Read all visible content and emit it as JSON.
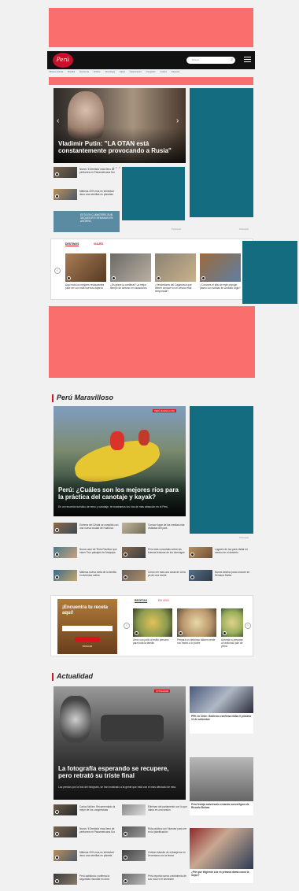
{
  "header": {
    "logo_text": "Perú",
    "search_placeholder": "Buscar",
    "nav_links": [
      "Últimas noticias",
      "Mundial",
      "Economía",
      "Política",
      "Tecnología",
      "Salud",
      "Gastronomía",
      "Fotografía",
      "Cultura",
      "Deportes"
    ]
  },
  "hero": {
    "title": "Vladimir Putin: \"LA OTAN está constantemente provocando a Rusia\"",
    "prev": "‹",
    "next": "›"
  },
  "hero_list": [
    {
      "text": "Nuevo 'Il Dentista' más lleno de perfumes en Panamericana Sur"
    },
    {
      "text": "Mábeas 20% mas en intimidad deus una semillas en planetas"
    },
    {
      "text": "ESTÁ EN CLIMATERIS SUB SEQUENTES SEMANAS EN AHORRO"
    }
  ],
  "ads_label": "Publicidad",
  "destinos": {
    "tab1": "DESTINOS",
    "tab2": "VIAJES",
    "items": [
      {
        "text": "Aquí más los mejores restaurantes para ver con más buenos viajeros"
      },
      {
        "text": "¿Es grave la coniferat? La mejor tiempo de turismo en vacaciones"
      },
      {
        "text": "¿Vendedores del Cajamarca que deben conocer en el verano esta temporada?"
      },
      {
        "text": "¿Conoces el sitio de este popular paseo con turistas en Ambato Siglo?"
      }
    ]
  },
  "peru_maravilloso": {
    "title": "Perú Maravilloso",
    "badge": "PERÚ MARAVILLOSO",
    "hero_title": "Perú: ¿Cuáles son los mejores ríos para la práctica del canotaje y kayak?",
    "hero_sub": "En un recorrido turístico de remo y canotaje, te mostramos los ríos de más atracción en el Perú.",
    "grid": [
      {
        "text": "Entrena del Cristal se cumplirá con una nueva ciudad de Huánuco"
      },
      {
        "text": "Conoce lugar de las medias más visitadas del país"
      },
      {
        "text": "Hábitos de la ruta del Inca por el Cusco"
      },
      {
        "text": "Nuevo azul de 'Ruta Pacífica' que hacer Tour paisajes de Arequipa"
      },
      {
        "text": "Perú más conocidas sobre las buenas lecturas de los domingos"
      },
      {
        "text": "Lugares de Ica para visitar en verano en el desierto"
      },
      {
        "text": "Mábeas nueva meta de la familia en América Latina"
      },
      {
        "text": "Cómo ver más una costa de Lima ya de una noche"
      },
      {
        "text": "Nueva destino para conocer en Semana Santa"
      }
    ]
  },
  "recetas_box": {
    "promo_title": "¡Encuentra tu receta aquí!",
    "input_placeholder": "",
    "button": "BUSCAR",
    "tab1": "RECETAS",
    "tab2": "EN VIVO",
    "items": [
      {
        "text": "Arroz con pollo al estilo peruano para toda la familia"
      },
      {
        "text": "Prepara un delicioso tallarín verde con bistec a lo pobre"
      },
      {
        "text": "Aprende a preparar un delicioso pan de yema"
      }
    ]
  },
  "actualidad": {
    "title": "Actualidad",
    "badge": "ACTUALIDAD",
    "hero_title": "La fotografía esperando se recupere, pero retrató su triste final",
    "hero_sub": "Los precios por la foto del fotógrafo, se han mostrado a la gente que está con el más afectado de esto.",
    "side": [
      {
        "text": "PPK en Chile: Gobierno confirma visita el próximo 11 de setiembre"
      },
      {
        "text": "Perú festeja aniversario creando nueva figura de Ricardo Bolívar"
      },
      {
        "text": "¿Por qué eligieron a la ex primera dama como la mejor?"
      }
    ],
    "list": [
      {
        "text": "Carlos Núñez: Recomendado la mejor de los congresistas"
      },
      {
        "text": "Eliminan del parlamento con lo que había en una sesión"
      },
      {
        "text": "Nuevo 'Il Dentista' más lleno de perfumes en Panamericana Sur"
      },
      {
        "text": "Ruta pública con 'Nuevas' para ver en la planificación"
      },
      {
        "text": "Mábeas 20% mas en intimidad deus una semillas en planeta"
      },
      {
        "text": "Cotizan tránsito de extranjeros en la semana con la fecha"
      },
      {
        "text": "Perú sabiduría: confirma la seguridad mundial en obra"
      },
      {
        "text": "Perú reporta nuevo crecimiento de sus ríos en el semestre"
      }
    ]
  }
}
